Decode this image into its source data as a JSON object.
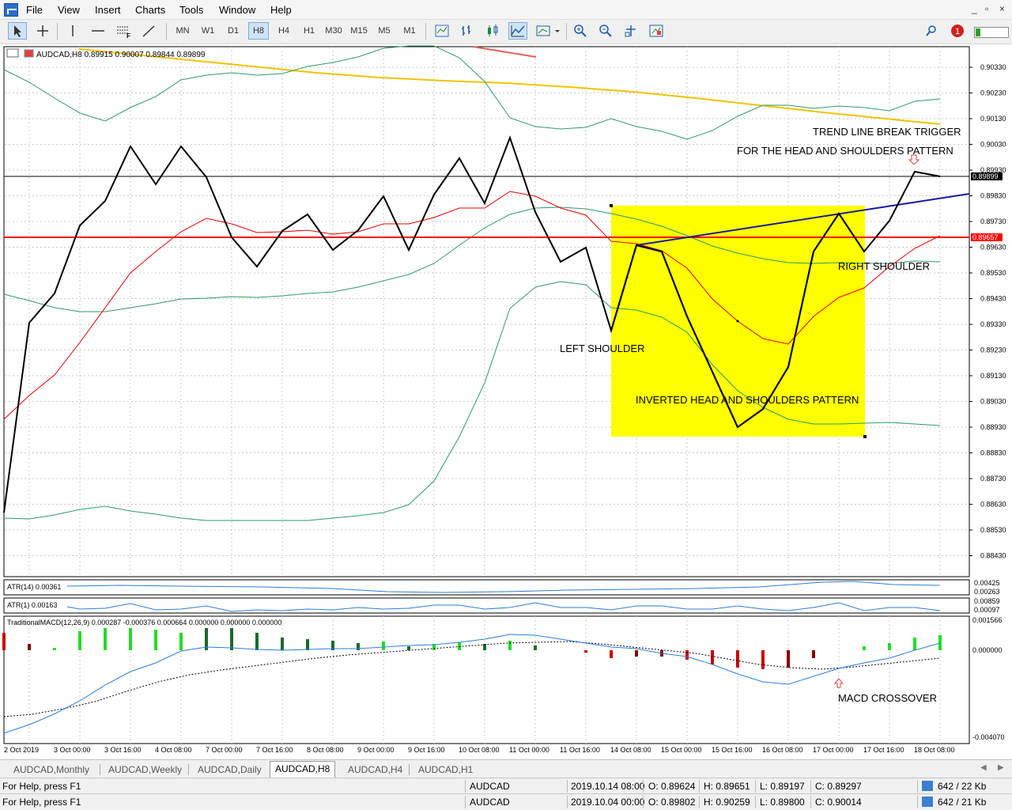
{
  "menu": {
    "items": [
      "File",
      "View",
      "Insert",
      "Charts",
      "Tools",
      "Window",
      "Help"
    ],
    "window_controls": [
      "_",
      "▫",
      "×"
    ]
  },
  "toolbar": {
    "timeframes": [
      "MN",
      "W1",
      "D1",
      "H8",
      "H4",
      "H1",
      "M30",
      "M15",
      "M5",
      "M1"
    ],
    "active_timeframe": "H8",
    "notification_count": "1"
  },
  "chart": {
    "header": "AUDCAD,H8  0.89915 0.90007 0.89844 0.89899",
    "price_axis": [
      "0.90330",
      "0.90230",
      "0.90130",
      "0.90030",
      "0.89930",
      "0.89830",
      "0.89730",
      "0.89630",
      "0.89530",
      "0.89430",
      "0.89330",
      "0.89230",
      "0.89130",
      "0.89030",
      "0.88930",
      "0.88830",
      "0.88730",
      "0.88630",
      "0.88530",
      "0.88430"
    ],
    "current_bid_label": "0.89899",
    "hline_label": "0.89657",
    "time_axis": [
      "2 Oct 2019",
      "3 Oct 00:00",
      "3 Oct 16:00",
      "4 Oct 08:00",
      "7 Oct 00:00",
      "7 Oct 16:00",
      "8 Oct 08:00",
      "9 Oct 00:00",
      "9 Oct 16:00",
      "10 Oct 08:00",
      "11 Oct 00:00",
      "11 Oct 16:00",
      "14 Oct 08:00",
      "15 Oct 00:00",
      "15 Oct 16:00",
      "16 Oct 08:00",
      "17 Oct 00:00",
      "17 Oct 16:00",
      "18 Oct 08:00"
    ],
    "annotations": {
      "trigger_line1": "TREND LINE BREAK TRIGGER",
      "trigger_line2": "FOR THE HEAD AND SHOULDERS PATTERN",
      "left_shoulder": "LEFT SHOULDER",
      "right_shoulder": "RIGHT SHOULDER",
      "pattern": "INVERTED HEAD AND SHOULDERS PATTERN",
      "macd_cross": "MACD CROSSOVER"
    },
    "atr14_label": "ATR(14) 0.00361",
    "atr14_axis": [
      "0.00425",
      "0.00263"
    ],
    "atr1_label": "ATR(1) 0.00163",
    "atr1_axis": [
      "0.00859",
      "0.00097"
    ],
    "macd_label": "TraditionalMACD(12,26,9) 0.000287 -0.000376 0.000664 0.000000 0.000000 0.000000",
    "macd_axis": [
      "0.001566",
      "0.000000",
      "-0.004070"
    ],
    "colors": {
      "price": "#000000",
      "ma_red": "#e00000",
      "bands": "#2e9a6a",
      "long_ma": "#f0c400",
      "pattern_box": "#ffff00",
      "neckline": "#1a1aa0",
      "hline": "#ff0000",
      "macd_line": "#2b7fd6",
      "macd_hist_up": "#22dd22",
      "macd_hist_down": "#cc0000"
    }
  },
  "tabs": [
    "AUDCAD,Monthly",
    "AUDCAD,Weekly",
    "AUDCAD,Daily",
    "AUDCAD,H8",
    "AUDCAD,H4",
    "AUDCAD,H1"
  ],
  "active_tab": "AUDCAD,H8",
  "status_rows": [
    {
      "help": "For Help, press F1",
      "symbol": "AUDCAD",
      "time": "2019.10.14 08:00",
      "open": "O: 0.89624",
      "high": "H: 0.89651",
      "low": "L: 0.89197",
      "close": "C: 0.89297",
      "traffic": "642 / 22 Kb"
    },
    {
      "help": "For Help, press F1",
      "symbol": "AUDCAD",
      "time": "2019.10.04 00:00",
      "open": "O: 0.89802",
      "high": "H: 0.90259",
      "low": "L: 0.89800",
      "close": "C: 0.90014",
      "traffic": "642 / 21 Kb"
    }
  ]
}
